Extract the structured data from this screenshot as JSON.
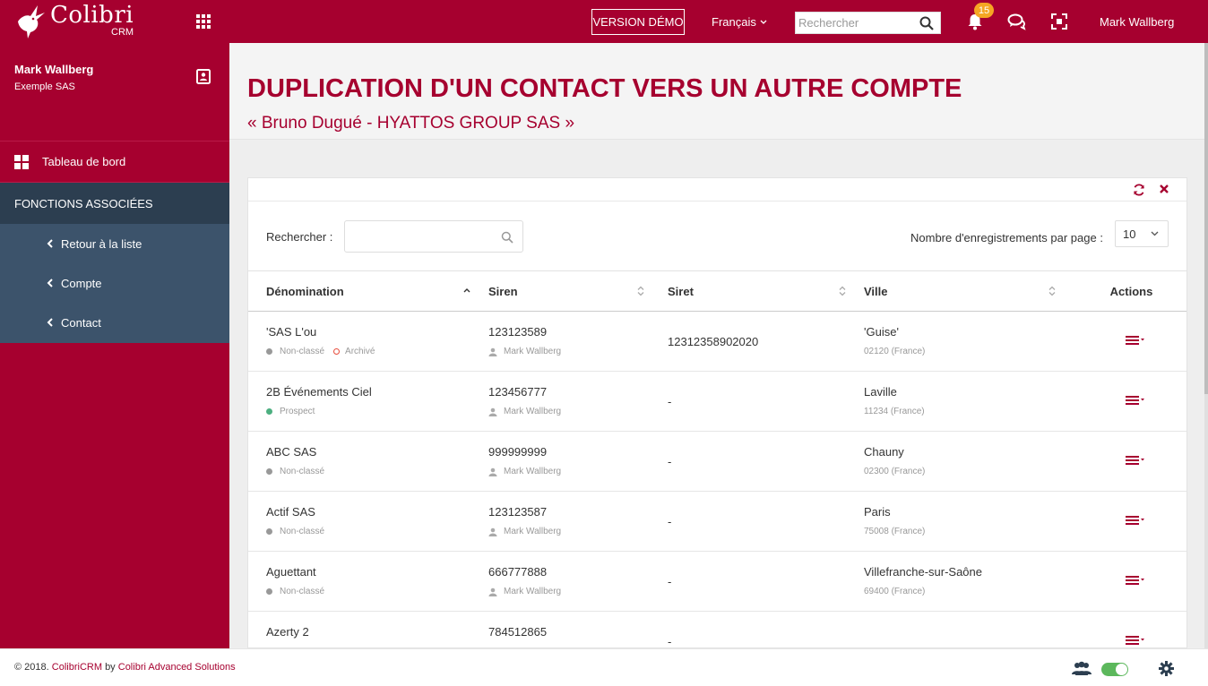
{
  "app": {
    "logo_name": "Colibri",
    "logo_sub": "CRM",
    "demo_label": "VERSION DÉMO",
    "language": "Français",
    "search_placeholder": "Rechercher",
    "notifications_count": "15",
    "user_name": "Mark Wallberg",
    "brand_color": "#a6002f"
  },
  "sidebar": {
    "user_name": "Mark Wallberg",
    "company": "Exemple SAS",
    "dashboard_label": "Tableau de bord",
    "section_title": "FONCTIONS ASSOCIÉES",
    "items": [
      {
        "label": "Retour à la liste"
      },
      {
        "label": "Compte"
      },
      {
        "label": "Contact"
      }
    ]
  },
  "page": {
    "title": "DUPLICATION D'UN CONTACT VERS UN AUTRE COMPTE",
    "subtitle": "« Bruno Dugué - HYATTOS GROUP SAS »"
  },
  "table": {
    "search_label": "Rechercher :",
    "per_page_label": "Nombre d'enregistrements par page :",
    "per_page_value": "10",
    "columns": [
      "Dénomination",
      "Siren",
      "Siret",
      "Ville",
      "Actions"
    ],
    "rows": [
      {
        "name": "'SAS L'ou",
        "status": "Non-classé",
        "status_color": "grey",
        "extra": "Archivé",
        "siren": "123123589",
        "owner": "Mark Wallberg",
        "siret": "12312358902020",
        "city": "'Guise'",
        "postcode": "02120 (France)"
      },
      {
        "name": "2B Événements Ciel",
        "status": "Prospect",
        "status_color": "green",
        "extra": "",
        "siren": "123456777",
        "owner": "Mark Wallberg",
        "siret": "-",
        "city": "Laville",
        "postcode": "11234 (France)"
      },
      {
        "name": "ABC SAS",
        "status": "Non-classé",
        "status_color": "grey",
        "extra": "",
        "siren": "999999999",
        "owner": "Mark Wallberg",
        "siret": "-",
        "city": "Chauny",
        "postcode": "02300 (France)"
      },
      {
        "name": "Actif SAS",
        "status": "Non-classé",
        "status_color": "grey",
        "extra": "",
        "siren": "123123587",
        "owner": "Mark Wallberg",
        "siret": "-",
        "city": "Paris",
        "postcode": "75008 (France)"
      },
      {
        "name": "Aguettant",
        "status": "Non-classé",
        "status_color": "grey",
        "extra": "",
        "siren": "666777888",
        "owner": "Mark Wallberg",
        "siret": "-",
        "city": "Villefranche-sur-Saône",
        "postcode": "69400 (France)"
      },
      {
        "name": "Azerty 2",
        "status": "",
        "status_color": "grey",
        "extra": "",
        "siren": "784512865",
        "owner": "",
        "siret": "-",
        "city": "",
        "postcode": ""
      }
    ]
  },
  "footer": {
    "copyright": "© 2018.",
    "product": "ColibriCRM",
    "by": "by",
    "company": "Colibri Advanced Solutions"
  }
}
